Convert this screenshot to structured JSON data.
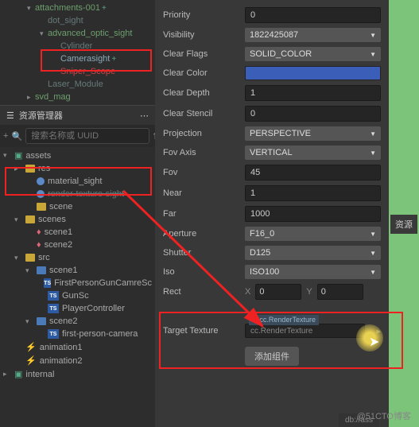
{
  "hierarchy": {
    "items": [
      {
        "label": "attachments-001",
        "indent": 2,
        "arrow": "▾",
        "plus": true,
        "green": true
      },
      {
        "label": "dot_sight",
        "indent": 3,
        "dim": true
      },
      {
        "label": "advanced_optic_sight",
        "indent": 3,
        "arrow": "▾",
        "green": true
      },
      {
        "label": "Cylinder",
        "indent": 4,
        "dim": true
      },
      {
        "label": "Camerasight",
        "indent": 4,
        "plus": true,
        "highlight": true
      },
      {
        "label": "Sniper_Scope",
        "indent": 4,
        "dim": true,
        "red": true
      },
      {
        "label": "Laser_Module",
        "indent": 3,
        "dim": true
      },
      {
        "label": "svd_mag",
        "indent": 2,
        "arrow": "▸",
        "green": true
      }
    ]
  },
  "assets_panel": {
    "title": "资源管理器",
    "search_placeholder": "搜索名称或 UUID"
  },
  "assets": [
    {
      "label": "assets",
      "i": 0,
      "type": "db",
      "arrow": "▾"
    },
    {
      "label": "res",
      "i": 1,
      "type": "folder",
      "arrow": "▸"
    },
    {
      "label": "material_sight",
      "i": 2,
      "type": "mat",
      "highlight": true
    },
    {
      "label": "render-texture-sight",
      "i": 2,
      "type": "mat",
      "dim": true
    },
    {
      "label": "scene",
      "i": 2,
      "type": "folder"
    },
    {
      "label": "scenes",
      "i": 1,
      "type": "folder",
      "arrow": "▾"
    },
    {
      "label": "scene1",
      "i": 2,
      "type": "fire"
    },
    {
      "label": "scene2",
      "i": 2,
      "type": "fire"
    },
    {
      "label": "src",
      "i": 1,
      "type": "folder",
      "arrow": "▾"
    },
    {
      "label": "scene1",
      "i": 2,
      "type": "folder-blue",
      "arrow": "▾"
    },
    {
      "label": "FirstPersonGunCamreSc",
      "i": 3,
      "type": "ts"
    },
    {
      "label": "GunSc",
      "i": 3,
      "type": "ts"
    },
    {
      "label": "PlayerController",
      "i": 3,
      "type": "ts"
    },
    {
      "label": "scene2",
      "i": 2,
      "type": "folder-blue",
      "arrow": "▾"
    },
    {
      "label": "first-person-camera",
      "i": 3,
      "type": "ts"
    },
    {
      "label": "animation1",
      "i": 1,
      "type": "anim"
    },
    {
      "label": "animation2",
      "i": 1,
      "type": "anim"
    },
    {
      "label": "internal",
      "i": 0,
      "type": "db",
      "arrow": "▸"
    }
  ],
  "inspector": {
    "priority": {
      "label": "Priority",
      "value": "0"
    },
    "visibility": {
      "label": "Visibility",
      "value": "1822425087"
    },
    "clear_flags": {
      "label": "Clear Flags",
      "value": "SOLID_COLOR"
    },
    "clear_color": {
      "label": "Clear Color"
    },
    "clear_depth": {
      "label": "Clear Depth",
      "value": "1"
    },
    "clear_stencil": {
      "label": "Clear Stencil",
      "value": "0"
    },
    "projection": {
      "label": "Projection",
      "value": "PERSPECTIVE"
    },
    "fov_axis": {
      "label": "Fov Axis",
      "value": "VERTICAL"
    },
    "fov": {
      "label": "Fov",
      "value": "45"
    },
    "near": {
      "label": "Near",
      "value": "1"
    },
    "far": {
      "label": "Far",
      "value": "1000"
    },
    "aperture": {
      "label": "Aperture",
      "value": "F16_0"
    },
    "shutter": {
      "label": "Shutter",
      "value": "D125"
    },
    "iso": {
      "label": "Iso",
      "value": "ISO100"
    },
    "rect": {
      "label": "Rect",
      "x_label": "X",
      "x": "0",
      "y_label": "Y",
      "y": "0"
    },
    "target_texture": {
      "label": "Target Texture",
      "tag": "◆ cc.RenderTexture",
      "value": "cc.RenderTexture"
    },
    "add_button": "添加组件"
  },
  "ext_tab": "资源",
  "watermark": "@51CTO博客",
  "bottom_tab": "db://ass"
}
